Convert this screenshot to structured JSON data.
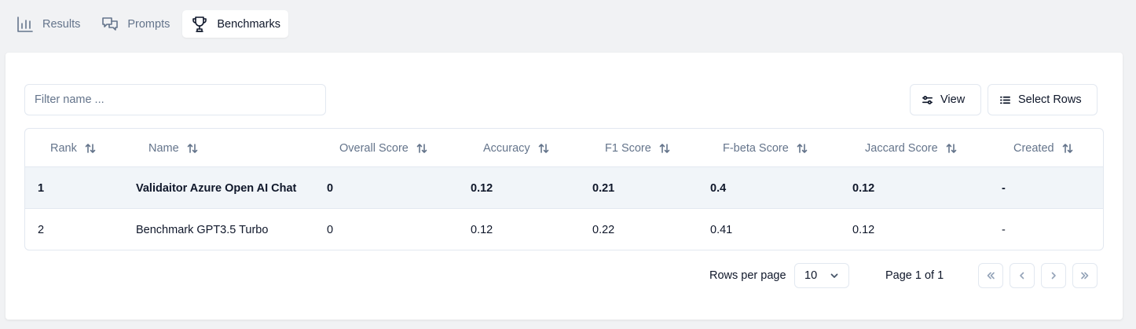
{
  "tabs": [
    {
      "label": "Results",
      "icon": "bar-chart-icon",
      "active": false
    },
    {
      "label": "Prompts",
      "icon": "chat-bubbles-icon",
      "active": false
    },
    {
      "label": "Benchmarks",
      "icon": "trophy-icon",
      "active": true
    }
  ],
  "toolbar": {
    "filter_placeholder": "Filter name ...",
    "filter_value": "",
    "view_label": "View",
    "select_rows_label": "Select Rows"
  },
  "table": {
    "columns": [
      "Rank",
      "Name",
      "Overall Score",
      "Accuracy",
      "F1 Score",
      "F-beta Score",
      "Jaccard Score",
      "Created"
    ],
    "rows": [
      [
        "1",
        "Validaitor Azure Open AI Chat",
        "0",
        "0.12",
        "0.21",
        "0.4",
        "0.12",
        "-"
      ],
      [
        "2",
        "Benchmark GPT3.5 Turbo",
        "0",
        "0.12",
        "0.22",
        "0.41",
        "0.12",
        "-"
      ]
    ]
  },
  "pagination": {
    "rows_per_page_label": "Rows per page",
    "rows_per_page_value": "10",
    "page_info": "Page 1 of 1"
  }
}
